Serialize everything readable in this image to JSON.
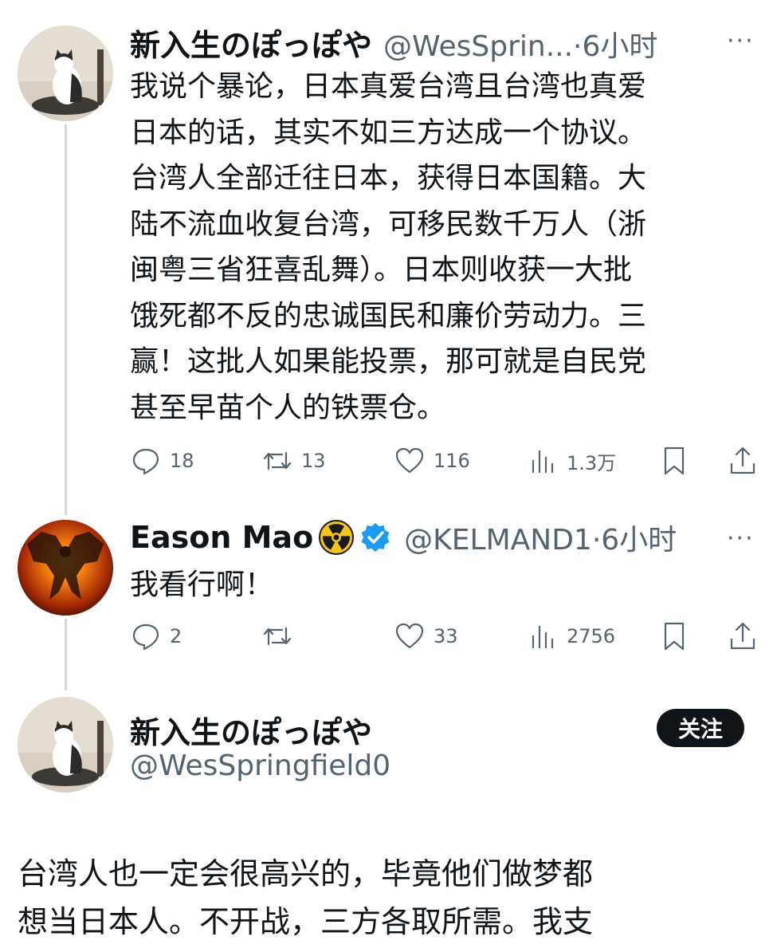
{
  "tweet1": {
    "display_name": "新入生のぽっぽや",
    "handle_time": "@WesSprin...·6小时",
    "more": "···",
    "text_lines": [
      "我说个暴论，日本真爱台湾且台湾也真爱",
      "日本的话，其实不如三方达成一个协议。",
      "台湾人全部迁往日本，获得日本国籍。大",
      "陆不流血收复台湾，可移民数千万人（浙",
      "闽粤三省狂喜乱舞）。日本则收获一大批",
      "饿死都不反的忠诚国民和廉价劳动力。三",
      "赢！这批人如果能投票，那可就是自民党",
      "甚至早苗个人的铁票仓。"
    ],
    "actions": {
      "replies": "18",
      "retweets": "13",
      "likes": "116",
      "views": "1.3万"
    }
  },
  "tweet2": {
    "display_name": "Eason Mao",
    "handle_time": "@KELMAND1·6小时",
    "more": "···",
    "text": "我看行啊！",
    "actions": {
      "replies": "2",
      "retweets": "",
      "likes": "33",
      "views": "2756"
    }
  },
  "tweet3": {
    "display_name": "新入生のぽっぽや",
    "handle": "@WesSpringfield0",
    "follow_label": "关注",
    "text_lines": [
      "台湾人也一定会很高兴的，毕竟他们做梦都",
      "想当日本人。不开战，三方各取所需。我支"
    ]
  },
  "colors": {
    "text": "#0f1419",
    "secondary": "#536471",
    "verified": "#1d9bf0",
    "radioactive": "#f5c518",
    "thread_line": "#cfd9de"
  }
}
